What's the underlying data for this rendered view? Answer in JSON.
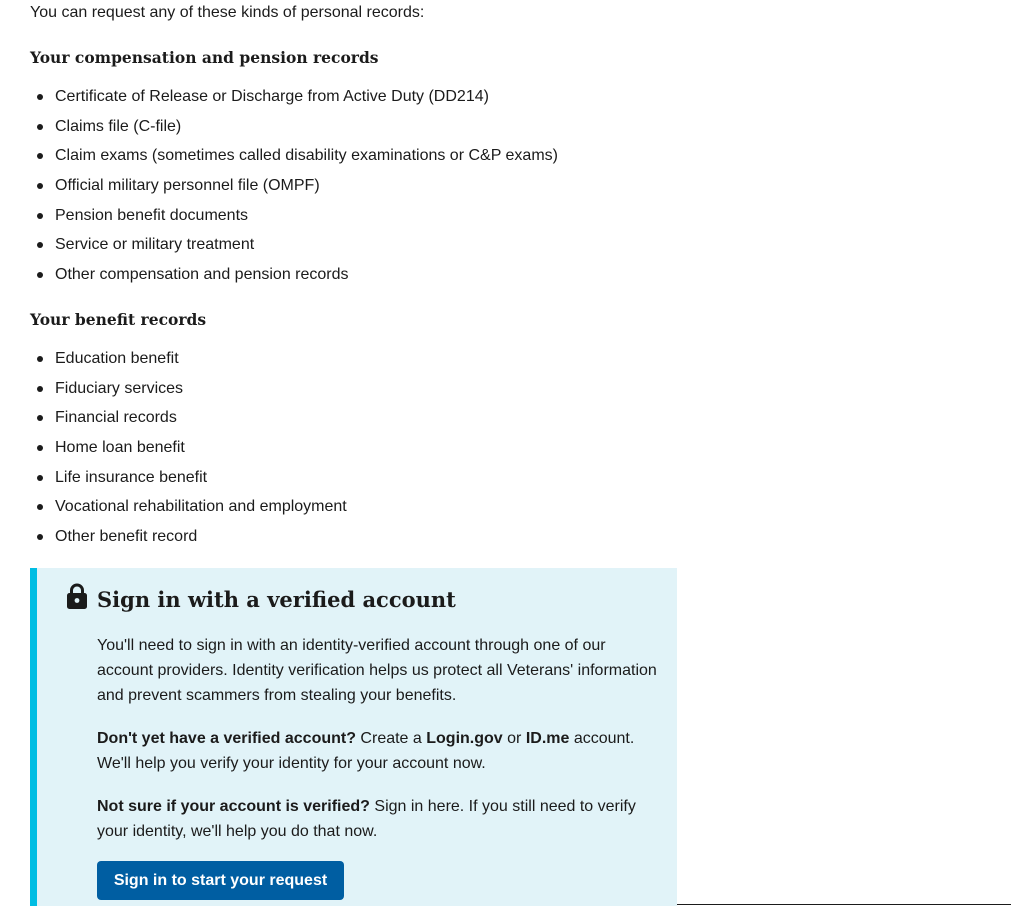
{
  "intro": "You can request any of these kinds of personal records:",
  "compensation": {
    "heading": "Your compensation and pension records",
    "items": [
      "Certificate of Release or Discharge from Active Duty (DD214)",
      "Claims file (C-file)",
      "Claim exams (sometimes called disability examinations or C&P exams)",
      "Official military personnel file (OMPF)",
      "Pension benefit documents",
      "Service or military treatment",
      "Other compensation and pension records"
    ]
  },
  "benefits": {
    "heading": "Your benefit records",
    "items": [
      "Education benefit",
      "Fiduciary services",
      "Financial records",
      "Home loan benefit",
      "Life insurance benefit",
      "Vocational rehabilitation and employment",
      "Other benefit record"
    ]
  },
  "alert": {
    "icon": "lock-icon",
    "title": "Sign in with a verified account",
    "paragraph1": "You'll need to sign in with an identity-verified account through one of our account providers. Identity verification helps us protect all Veterans' information and prevent scammers from stealing your benefits.",
    "paragraph2": {
      "lead": "Don't yet have a verified account?",
      "text_a": " Create a ",
      "provider1": "Login.gov",
      "text_b": " or ",
      "provider2": "ID.me",
      "text_c": " account. We'll help you verify your identity for your account now."
    },
    "paragraph3": {
      "lead": "Not sure if your account is verified?",
      "text": " Sign in here. If you still need to verify your identity, we'll help you do that now."
    },
    "button_label": "Sign in to start your request"
  },
  "colors": {
    "alert_background": "#e1f3f8",
    "alert_border": "#00bde3",
    "button": "#005ea2",
    "text": "#1b1b1b"
  }
}
